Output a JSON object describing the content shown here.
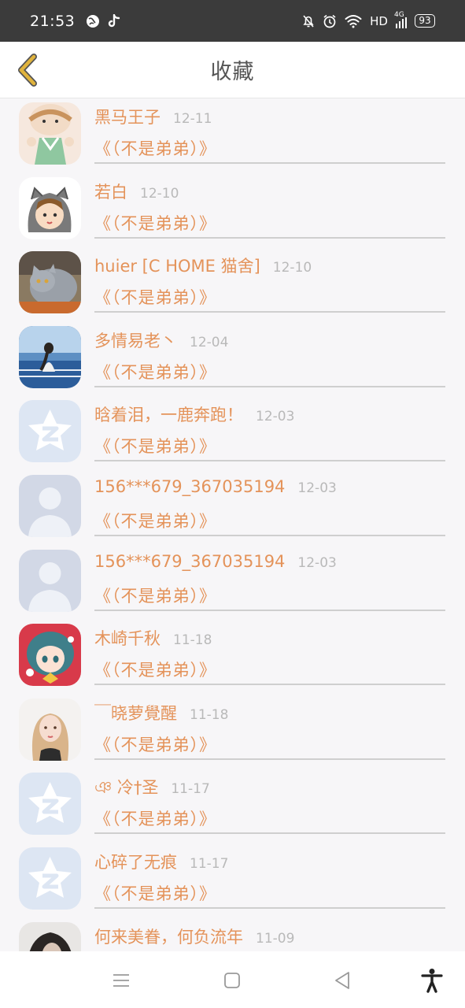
{
  "status_bar": {
    "time": "21:53",
    "network": "HD",
    "signal_label": "4G",
    "battery": "93",
    "icons": [
      "globe-icon",
      "tiktok-icon",
      "mute-bell-icon",
      "alarm-icon",
      "wifi-icon",
      "signal-icon"
    ]
  },
  "header": {
    "title": "收藏",
    "back_icon": "chevron-left-icon"
  },
  "items": [
    {
      "name": "黑马王子",
      "date": "12-11",
      "title": "《（不是弟弟）》",
      "avatar": "cartoon-girl-green"
    },
    {
      "name": "若白",
      "date": "12-10",
      "title": "《（不是弟弟）》",
      "avatar": "cartoon-boy-cat-hood"
    },
    {
      "name": "huier [C HOME 猫舍]",
      "date": "12-10",
      "title": "《（不是弟弟）》",
      "avatar": "grey-cat-photo"
    },
    {
      "name": "多情易老丶",
      "date": "12-04",
      "title": "《（不是弟弟）》",
      "avatar": "sea-girl-photo"
    },
    {
      "name": "晗着泪，一鹿奔跑！",
      "date": "12-03",
      "title": "《（不是弟弟）》",
      "avatar": "qzone-star-default"
    },
    {
      "name": "156***679_367035194",
      "date": "12-03",
      "title": "《（不是弟弟）》",
      "avatar": "default-person"
    },
    {
      "name": "156***679_367035194",
      "date": "12-03",
      "title": "《（不是弟弟）》",
      "avatar": "default-person"
    },
    {
      "name": "木崎千秋",
      "date": "11-18",
      "title": "《（不是弟弟）》",
      "avatar": "anime-girl-teal"
    },
    {
      "name": "￣晓萝覺醒",
      "date": "11-18",
      "title": "《（不是弟弟）》",
      "avatar": "blonde-girl-photo"
    },
    {
      "name": "ঞ 冷†圣",
      "date": "11-17",
      "title": "《（不是弟弟）》",
      "avatar": "qzone-star-default"
    },
    {
      "name": "心碎了无痕",
      "date": "11-17",
      "title": "《（不是弟弟）》",
      "avatar": "qzone-star-default"
    },
    {
      "name": "何来美眷，何负流年",
      "date": "11-09",
      "title": "",
      "avatar": "dark-hair-photo"
    }
  ],
  "nav_bar": {
    "icons": [
      "menu-icon",
      "home-square-icon",
      "back-triangle-icon",
      "accessibility-icon"
    ]
  },
  "colors": {
    "accent": "#e4935a",
    "date": "#b9b9b9",
    "status_bar": "#3b3b3b",
    "background": "#f7f6f8",
    "back_arrow": "#e0b33c"
  }
}
